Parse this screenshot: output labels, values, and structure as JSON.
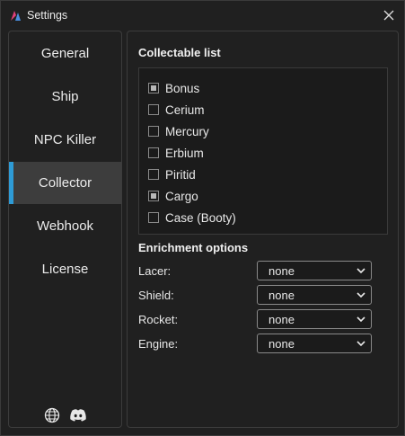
{
  "window": {
    "title": "Settings",
    "accent_color": "#2e9bd6"
  },
  "sidebar": {
    "items": [
      {
        "label": "General",
        "active": false
      },
      {
        "label": "Ship",
        "active": false
      },
      {
        "label": "NPC Killer",
        "active": false
      },
      {
        "label": "Collector",
        "active": true
      },
      {
        "label": "Webhook",
        "active": false
      },
      {
        "label": "License",
        "active": false
      }
    ],
    "footer_icons": [
      "globe-icon",
      "discord-icon"
    ]
  },
  "collectable": {
    "title": "Collectable list",
    "items": [
      {
        "label": "Bonus",
        "checked": true
      },
      {
        "label": "Cerium",
        "checked": false
      },
      {
        "label": "Mercury",
        "checked": false
      },
      {
        "label": "Erbium",
        "checked": false
      },
      {
        "label": "Piritid",
        "checked": false
      },
      {
        "label": "Cargo",
        "checked": true
      },
      {
        "label": "Case (Booty)",
        "checked": false
      }
    ]
  },
  "enrichment": {
    "title": "Enrichment options",
    "options": [
      {
        "label": "Lacer:",
        "value": "none"
      },
      {
        "label": "Shield:",
        "value": "none"
      },
      {
        "label": "Rocket:",
        "value": "none"
      },
      {
        "label": "Engine:",
        "value": "none"
      }
    ]
  }
}
